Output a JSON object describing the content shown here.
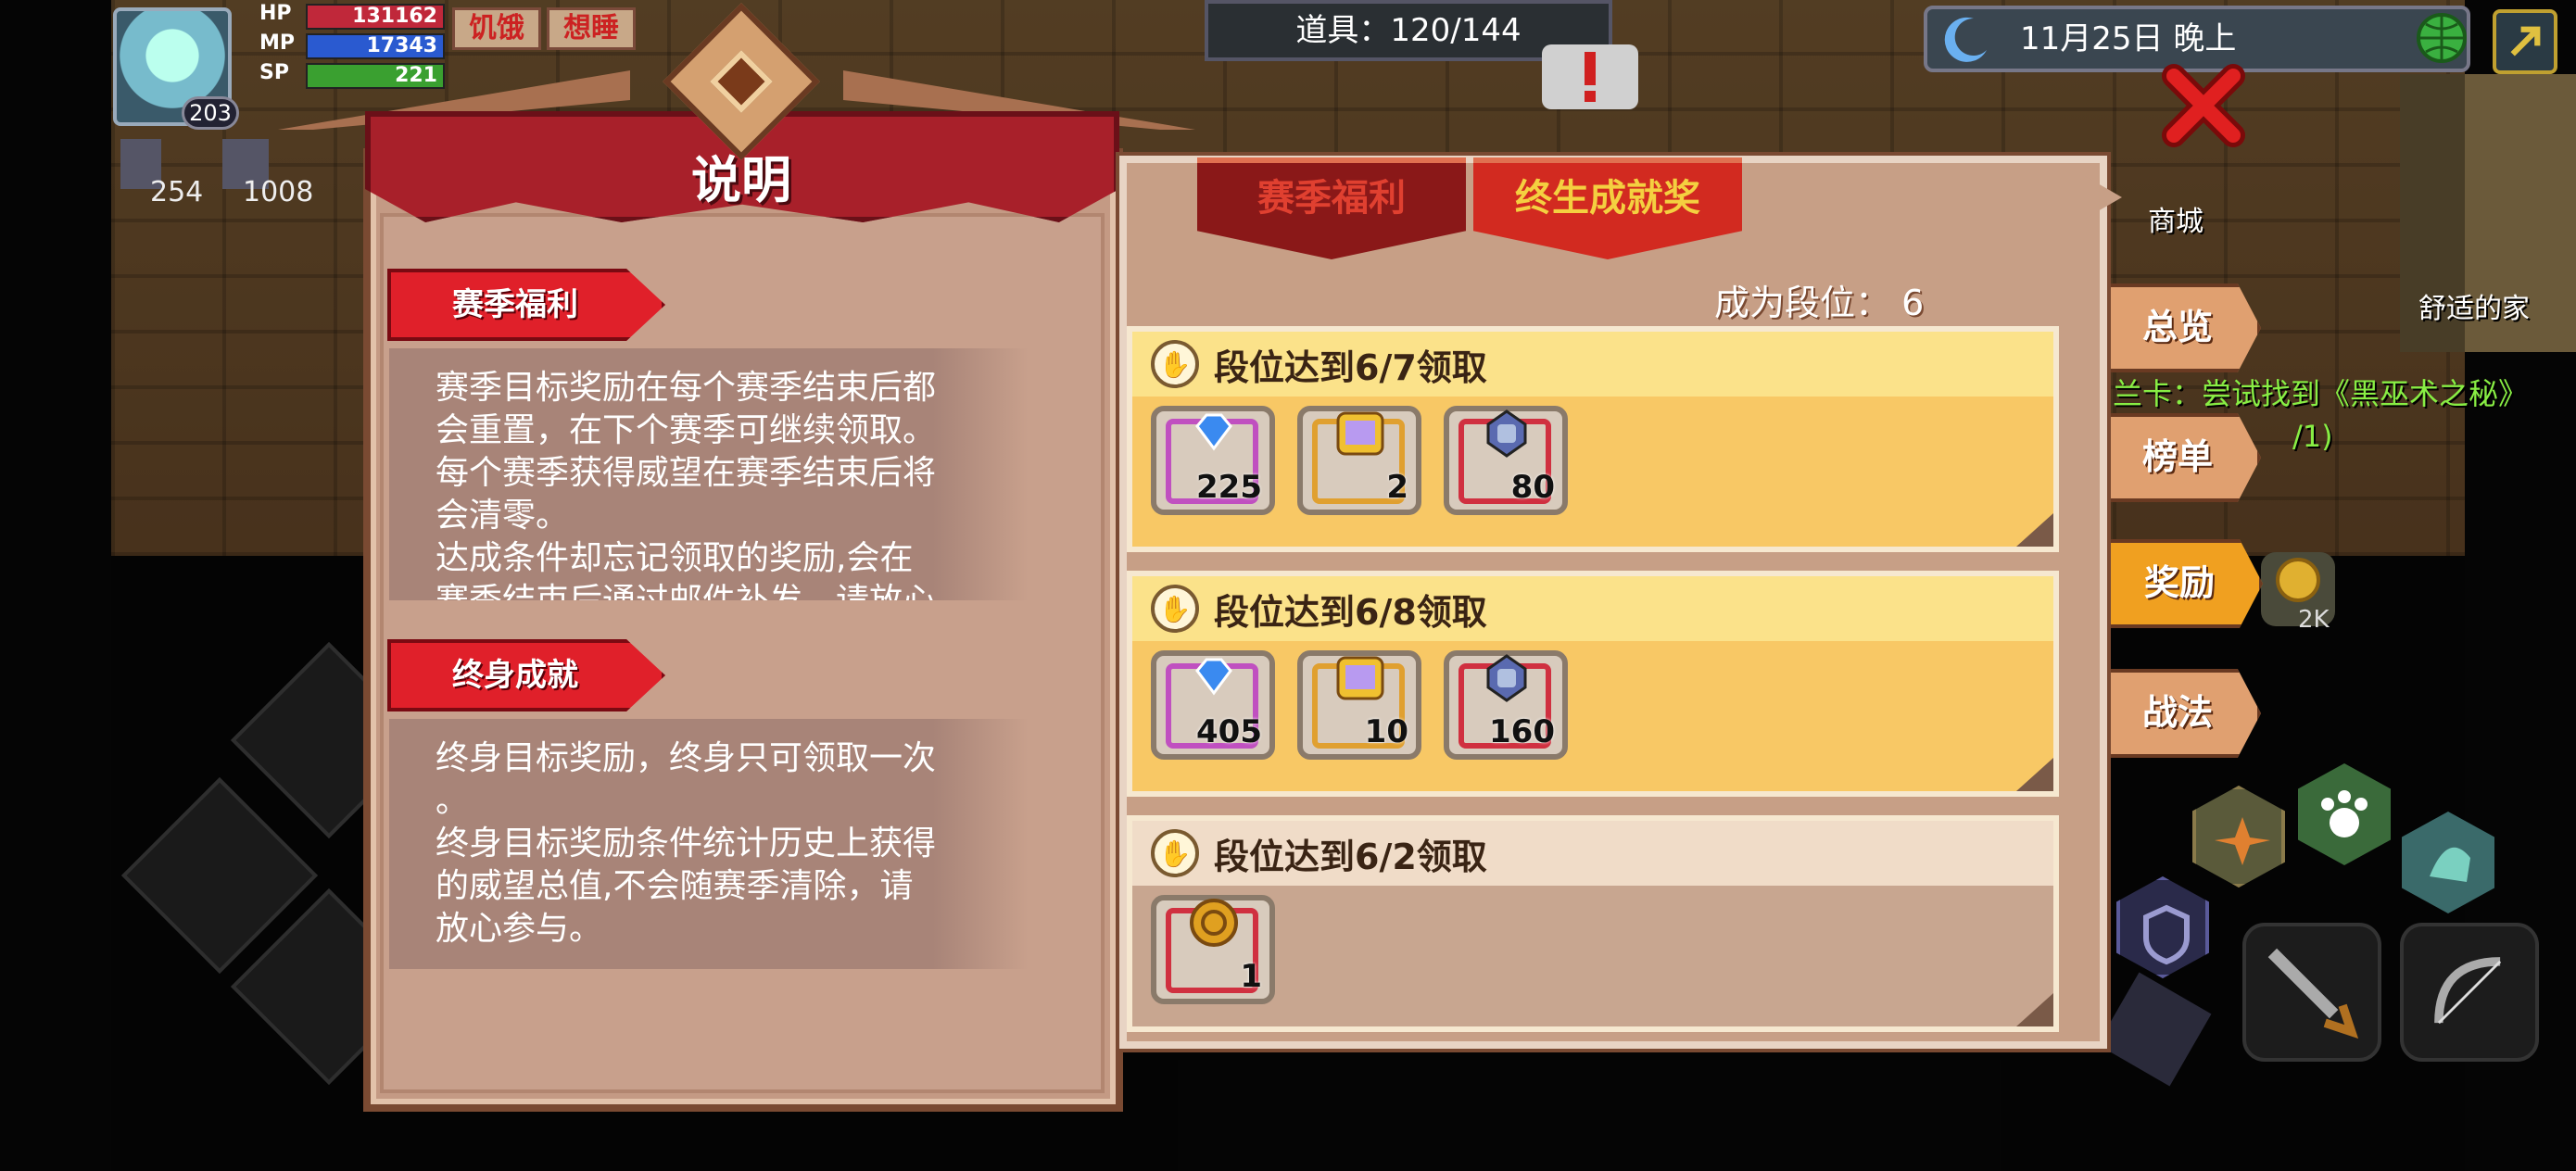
{
  "hud": {
    "hp_label": "HP",
    "hp_value": "131162",
    "mp_label": "MP",
    "mp_value": "17343",
    "sp_label": "SP",
    "sp_value": "221",
    "level": "203",
    "status_1": "饥饿",
    "status_2": "想睡",
    "stat_1": "254",
    "stat_2": "1008"
  },
  "top_bar": {
    "items": "道具：120/144",
    "date": "11月25日  晚上"
  },
  "scene": {
    "shop_label": "商城",
    "home_label": "舒适的家",
    "quest_text": "兰卡：尝试找到《黑巫术之秘》",
    "quest_progress": "/1)",
    "coin_count": "2K"
  },
  "side_tabs": [
    {
      "label": "总览"
    },
    {
      "label": "榜单"
    },
    {
      "label": "奖励"
    },
    {
      "label": "战法"
    }
  ],
  "info_panel": {
    "title": "说明",
    "section_1_tag": "赛季福利",
    "section_1_text": "赛季目标奖励在每个赛季结束后都\n会重置，在下个赛季可继续领取。\n每个赛季获得威望在赛季结束后将\n会清零。\n达成条件却忘记领取的奖励,会在\n赛季结束后通过邮件补发，请放心",
    "section_2_tag": "终身成就",
    "section_2_text": "终身目标奖励，终身只可领取一次\n。\n终身目标奖励条件统计历史上获得\n的威望总值,不会随赛季清除，请\n放心参与。"
  },
  "reward_panel": {
    "tab_season": "赛季福利",
    "tab_lifetime": "终生成就奖",
    "rank_label": "成为段位：  6",
    "cards": [
      {
        "title": "段位达到6/7领取",
        "items": [
          {
            "icon": "blue-gem-icon",
            "count": "225"
          },
          {
            "icon": "rainbow-chest-icon",
            "count": "2"
          },
          {
            "icon": "crystal-orb-icon",
            "count": "80"
          }
        ]
      },
      {
        "title": "段位达到6/8领取",
        "items": [
          {
            "icon": "blue-gem-icon",
            "count": "405"
          },
          {
            "icon": "rainbow-chest-icon",
            "count": "10"
          },
          {
            "icon": "crystal-orb-icon",
            "count": "160"
          }
        ]
      },
      {
        "title": "段位达到6/2领取",
        "items": [
          {
            "icon": "gold-coin-icon",
            "count": "1"
          }
        ]
      }
    ]
  },
  "colors": {
    "banner_red": "#a8202a",
    "tab_active": "#d22a20",
    "card_yellow": "#f8c865",
    "side_tab_active": "#f0a020"
  }
}
